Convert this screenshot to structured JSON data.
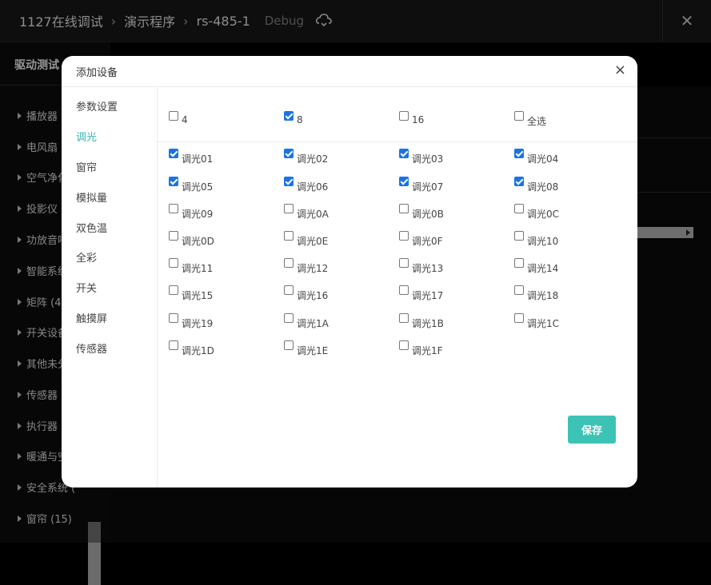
{
  "header": {
    "breadcrumb": [
      "1127在线调试",
      "演示程序",
      "rs-485-1"
    ],
    "mode": "Debug",
    "close_glyph": "✕"
  },
  "left_panel": {
    "title": "驱动测试",
    "items": [
      "播放器 (",
      "电风扇 (",
      "空气净化",
      "投影仪 (",
      "功放音响",
      "智能系统",
      "矩阵 (4)",
      "开关设备",
      "其他未分",
      "传感器 (",
      "执行器 (",
      "暖通与空",
      "安全系统 (",
      "窗帘 (15)"
    ]
  },
  "modal": {
    "title": "添加设备",
    "close_glyph": "×",
    "nav": [
      "参数设置",
      "调光",
      "窗帘",
      "模拟量",
      "双色温",
      "全彩",
      "开关",
      "触摸屏",
      "传感器"
    ],
    "active_nav": "调光",
    "group_options": [
      {
        "label": "4",
        "checked": false
      },
      {
        "label": "8",
        "checked": true
      },
      {
        "label": "16",
        "checked": false
      },
      {
        "label": "全选",
        "checked": false
      }
    ],
    "devices": [
      {
        "label": "调光01",
        "checked": true
      },
      {
        "label": "调光02",
        "checked": true
      },
      {
        "label": "调光03",
        "checked": true
      },
      {
        "label": "调光04",
        "checked": true
      },
      {
        "label": "调光05",
        "checked": true
      },
      {
        "label": "调光06",
        "checked": true
      },
      {
        "label": "调光07",
        "checked": true
      },
      {
        "label": "调光08",
        "checked": true
      },
      {
        "label": "调光09",
        "checked": false
      },
      {
        "label": "调光0A",
        "checked": false
      },
      {
        "label": "调光0B",
        "checked": false
      },
      {
        "label": "调光0C",
        "checked": false
      },
      {
        "label": "调光0D",
        "checked": false
      },
      {
        "label": "调光0E",
        "checked": false
      },
      {
        "label": "调光0F",
        "checked": false
      },
      {
        "label": "调光10",
        "checked": false
      },
      {
        "label": "调光11",
        "checked": false
      },
      {
        "label": "调光12",
        "checked": false
      },
      {
        "label": "调光13",
        "checked": false
      },
      {
        "label": "调光14",
        "checked": false
      },
      {
        "label": "调光15",
        "checked": false
      },
      {
        "label": "调光16",
        "checked": false
      },
      {
        "label": "调光17",
        "checked": false
      },
      {
        "label": "调光18",
        "checked": false
      },
      {
        "label": "调光19",
        "checked": false
      },
      {
        "label": "调光1A",
        "checked": false
      },
      {
        "label": "调光1B",
        "checked": false
      },
      {
        "label": "调光1C",
        "checked": false
      },
      {
        "label": "调光1D",
        "checked": false
      },
      {
        "label": "调光1E",
        "checked": false
      },
      {
        "label": "调光1F",
        "checked": false
      }
    ],
    "save_label": "保存"
  },
  "colors": {
    "accent": "#33b8b1",
    "save_button": "#3cc3b6",
    "checkbox_checked": "#1a73e8"
  }
}
